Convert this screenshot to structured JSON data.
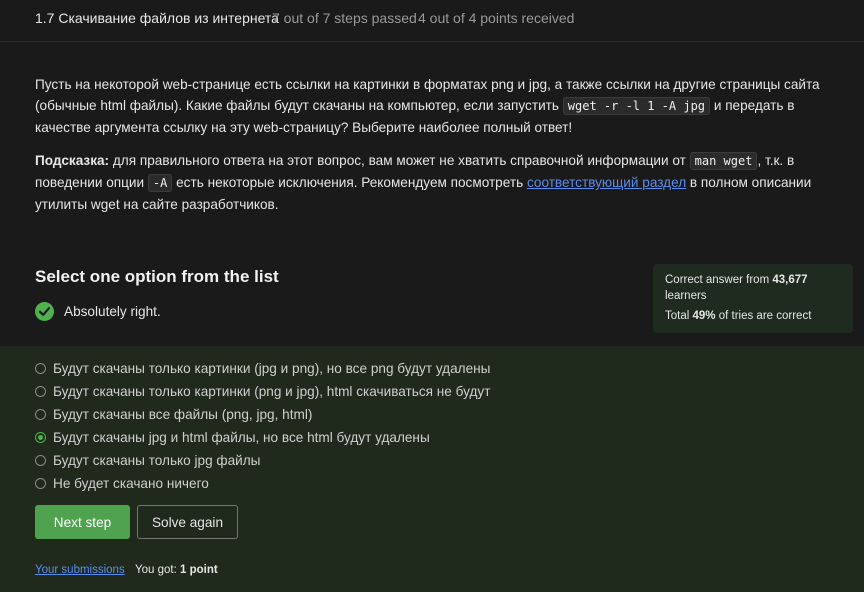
{
  "header": {
    "title": "1.7 Скачивание файлов из интернета",
    "steps": "7 out of 7 steps passed",
    "points": "4 out of 4 points  received"
  },
  "question": {
    "p1_a": "Пусть на некоторой web-странице есть ссылки на картинки в форматах png и jpg, а также ссылки на другие страницы сайта (обычные html файлы). Какие файлы будут скачаны на компьютер, если запустить ",
    "p1_code": "wget -r -l 1 -A jpg",
    "p1_b": " и передать в качестве аргумента ссылку на эту web-страницу? Выберите наиболее полный ответ!",
    "hint_label": "Подсказка:",
    "p2_a": " для правильного ответа на этот вопрос, вам может не хватить справочной информации от ",
    "p2_code1": "man wget",
    "p2_b": ", т.к. в поведении опции ",
    "p2_code2": "-A",
    "p2_c": " есть некоторые исключения. Рекомендуем посмотреть ",
    "p2_link": "соответствующий раздел",
    "p2_d": " в полном описании утилиты wget на сайте разработчиков."
  },
  "select_title": "Select one option from the list",
  "result_text": "Absolutely right.",
  "stats": {
    "correct_prefix": "Correct answer from ",
    "correct_count": "43,677",
    "correct_suffix": " learners",
    "total_prefix": "Total ",
    "total_percent": "49%",
    "total_suffix": " of tries are correct"
  },
  "options": [
    {
      "label": "Будут скачаны только картинки (jpg и png), но все png будут удалены",
      "checked": false
    },
    {
      "label": "Будут скачаны только картинки (png и jpg), html скачиваться не будут",
      "checked": false
    },
    {
      "label": "Будут скачаны все файлы (png, jpg, html)",
      "checked": false
    },
    {
      "label": "Будут скачаны jpg и html файлы, но все html будут удалены",
      "checked": true
    },
    {
      "label": "Будут скачаны только jpg файлы",
      "checked": false
    },
    {
      "label": "Не будет скачано ничего",
      "checked": false
    }
  ],
  "buttons": {
    "next": "Next step",
    "solve": "Solve again"
  },
  "footer": {
    "submissions": "Your submissions",
    "got_prefix": "You got: ",
    "got_value": "1 point"
  },
  "colors": {
    "accent_green": "#4fa34f",
    "link_blue": "#5a8dee",
    "panel_bg": "#1f2a1d"
  }
}
